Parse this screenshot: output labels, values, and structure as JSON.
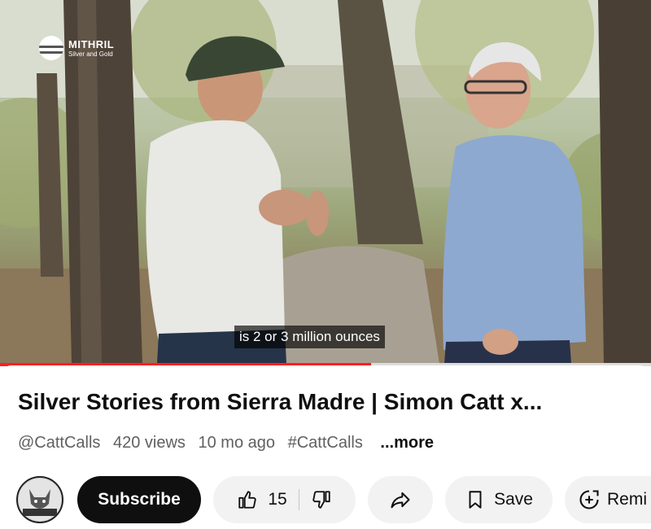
{
  "video": {
    "logo_title": "MITHRIL",
    "logo_subtitle": "Silver and Gold",
    "caption": "is 2 or 3 million ounces",
    "progress_fraction": 0.57
  },
  "title": "Silver Stories from Sierra Madre | Simon Catt x...",
  "meta": {
    "channel": "@CattCalls",
    "views": "420 views",
    "age": "10 mo ago",
    "hashtag": "#CattCalls",
    "more": "...more"
  },
  "channel_avatar_text": "CATTCALLS",
  "actions": {
    "subscribe": "Subscribe",
    "like_count": "15",
    "save": "Save",
    "remix": "Remi"
  },
  "colors": {
    "progress": "#ff1e1e",
    "subscribe_bg": "#0f0f0f",
    "chip_bg": "#f2f2f2"
  }
}
